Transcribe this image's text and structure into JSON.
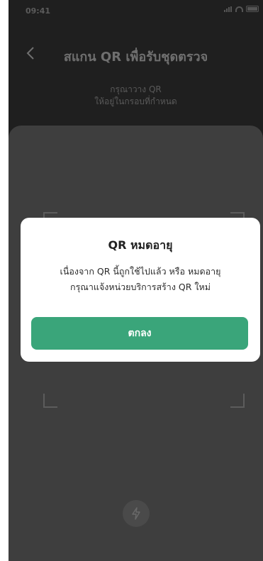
{
  "status_bar": {
    "time": "09:41"
  },
  "header": {
    "title": "สแกน QR เพื่อรับชุดตรวจ",
    "back_icon": "chevron-left-icon"
  },
  "instruction": {
    "line1": "กรุณาวาง QR",
    "line2": "ให้อยู่ในกรอบที่กำหนด"
  },
  "camera": {
    "flash_icon": "flash-icon"
  },
  "dialog": {
    "title": "QR หมดอายุ",
    "message_line1": "เนื่องจาก QR นี้ถูกใช้ไปแล้ว หรือ หมดอายุ",
    "message_line2": "กรุณาแจ้งหน่วยบริการสร้าง QR ใหม่",
    "ok_label": "ตกลง"
  },
  "colors": {
    "accent": "#3aa57a",
    "overlay_top": "#1f1f1f",
    "overlay_panel": "#3e3e3e",
    "dialog_bg": "#ffffff"
  }
}
